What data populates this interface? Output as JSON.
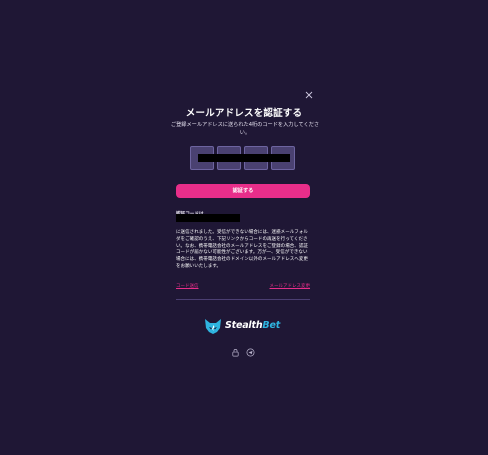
{
  "modal": {
    "title": "メールアドレスを認証する",
    "subtitle": "ご登録メールアドレスに送られた4桁のコードを入力してください。",
    "verify_button_label": "認証する",
    "code_label": "認証コードは",
    "notice": "に送信されました。受信ができない場合には、迷惑メールフォルダをご確認のうえ、下記リンクからコードの再送を行ってください。なお、携帯電話会社のメールアドレスをご登録の場合、認証コードが届かない可能性がございます。万が一、受信ができない場合には、携帯電話会社のドメイン以外のメールアドレスへ変更をお願いいたします。",
    "links": {
      "resend": "コード送信",
      "change_email": "メールアドレス変更"
    }
  },
  "brand": {
    "name_part1": "Stealth",
    "name_part2": "Bet",
    "accent_color": "#e82e8a",
    "logo_color": "#2fb4e0",
    "logo_icon": "fox-head-icon"
  },
  "footer": {
    "icons": [
      "lock-icon",
      "telegram-icon"
    ]
  },
  "colors": {
    "background": "#1f1735",
    "code_box": "#4a4171"
  }
}
